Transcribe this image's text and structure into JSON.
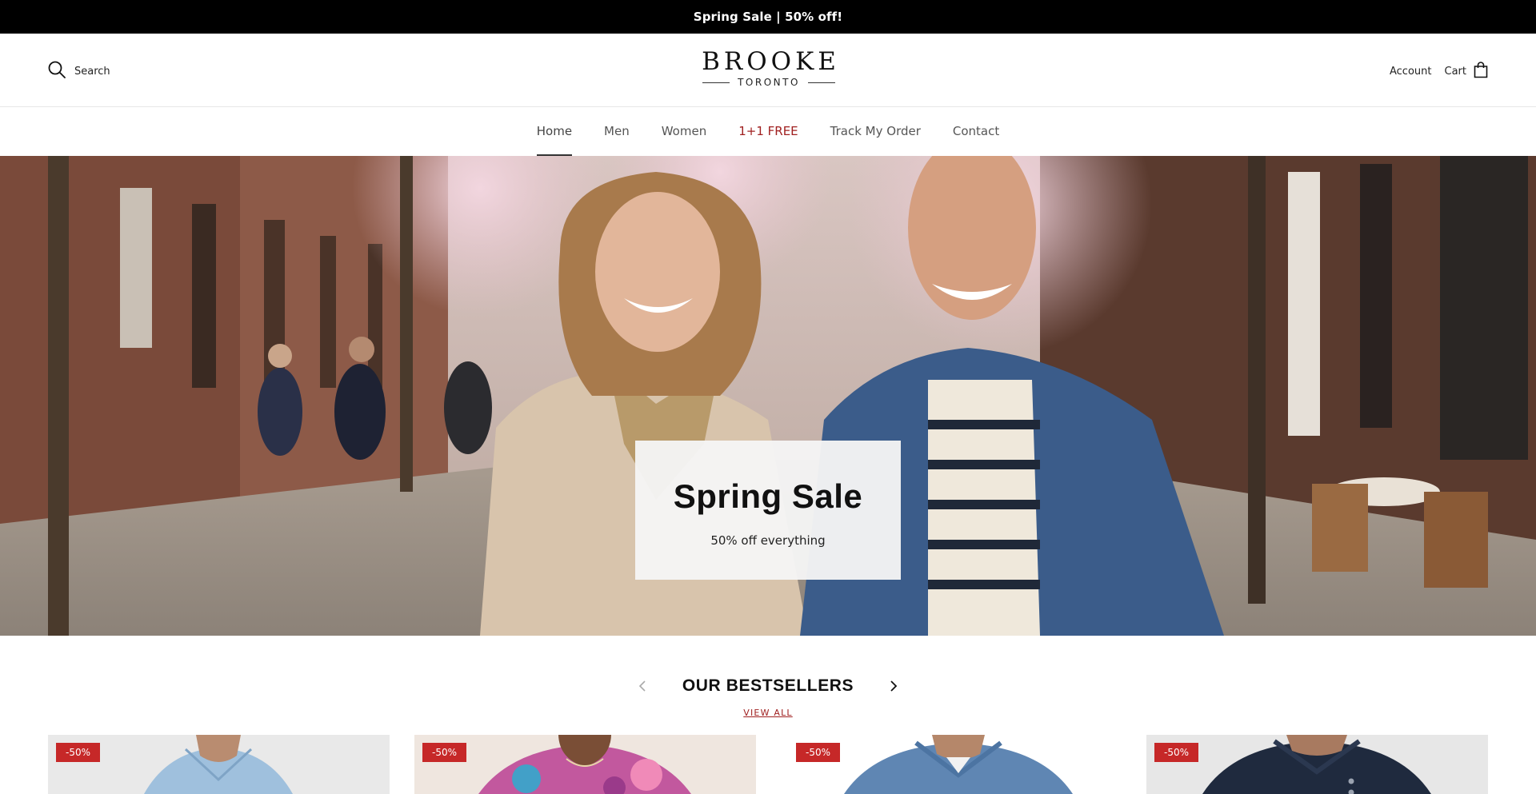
{
  "announcement": {
    "text": "Spring Sale | 50% off!"
  },
  "header": {
    "search_label": "Search",
    "logo": {
      "brand": "BROOKE",
      "city": "TORONTO"
    },
    "account_label": "Account",
    "cart_label": "Cart"
  },
  "nav": {
    "items": [
      {
        "label": "Home",
        "active": true
      },
      {
        "label": "Men"
      },
      {
        "label": "Women"
      },
      {
        "label": "1+1 FREE",
        "accent": "#a02020"
      },
      {
        "label": "Track My Order"
      },
      {
        "label": "Contact"
      }
    ]
  },
  "hero": {
    "title": "Spring Sale",
    "subtitle": "50% off everything"
  },
  "bestsellers": {
    "title": "OUR BESTSELLERS",
    "view_all": "VIEW ALL",
    "products": [
      {
        "badge": "-50%",
        "image": "man-light-blue-shirt"
      },
      {
        "badge": "-50%",
        "image": "woman-floral-blouse"
      },
      {
        "badge": "-50%",
        "image": "man-denim-shirt"
      },
      {
        "badge": "-50%",
        "image": "man-navy-shirt"
      }
    ]
  },
  "colors": {
    "sale_red": "#c62828",
    "promo_red": "#a02020",
    "announcement_bg": "#000000"
  }
}
